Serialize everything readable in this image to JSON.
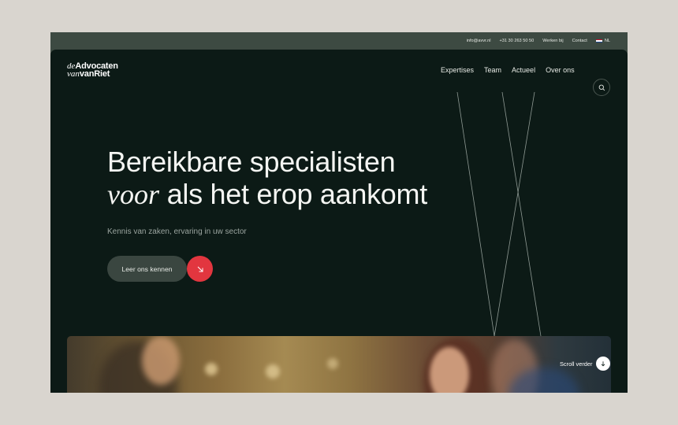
{
  "topbar": {
    "email": "info@avvr.nl",
    "phone": "+31 30 263 50 50",
    "jobs": "Werken bij",
    "contact": "Contact",
    "language": "NL"
  },
  "logo": {
    "line1_italic": "de",
    "line1_bold": "Advocaten",
    "line2_italic": "van",
    "line2_bold": "vanRiet"
  },
  "nav": {
    "items": [
      "Expertises",
      "Team",
      "Actueel",
      "Over ons"
    ],
    "search_icon": "search-icon"
  },
  "hero": {
    "title_line1": "Bereikbare specialisten",
    "title_line2_italic": "voor",
    "title_line2_rest": "als het erop aankomt",
    "subtitle": "Kennis van zaken, ervaring in uw sector",
    "cta_label": "Leer ons kennen",
    "cta_icon": "arrow-down-right-icon"
  },
  "photo": {
    "scroll_label": "Scroll verder",
    "scroll_icon": "arrow-down-icon"
  },
  "colors": {
    "page_bg": "#d9d5cf",
    "frame_bg": "#3d4a42",
    "hero_bg": "#0c1a16",
    "accent_red": "#e2363f",
    "button_bg": "#3a4640"
  }
}
